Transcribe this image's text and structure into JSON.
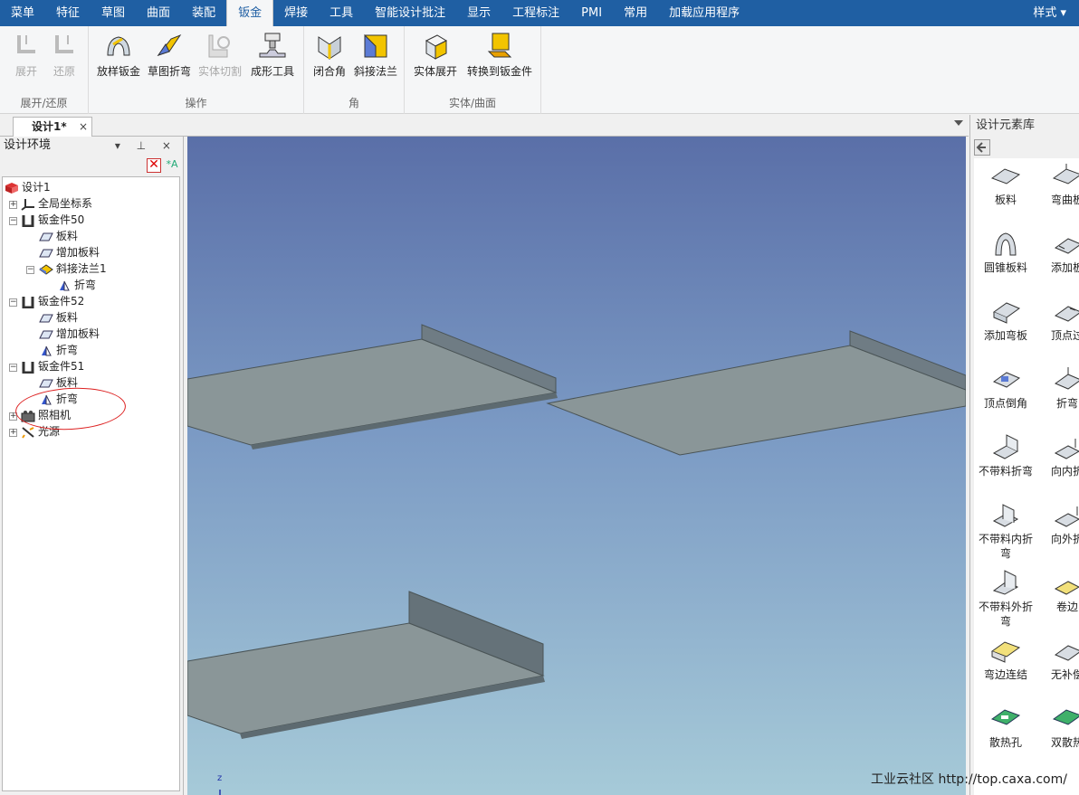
{
  "menubar": {
    "items": [
      "菜单",
      "特征",
      "草图",
      "曲面",
      "装配",
      "钣金",
      "焊接",
      "工具",
      "智能设计批注",
      "显示",
      "工程标注",
      "PMI",
      "常用",
      "加载应用程序"
    ],
    "active": "钣金",
    "style_menu": "样式 ▾"
  },
  "ribbon": {
    "groups": [
      {
        "label": "展开/还原",
        "buttons": [
          "展开",
          "还原"
        ]
      },
      {
        "label": "操作",
        "buttons": [
          "放样钣金",
          "草图折弯",
          "实体切割",
          "成形工具"
        ]
      },
      {
        "label": "角",
        "buttons": [
          "闭合角",
          "斜接法兰"
        ]
      },
      {
        "label": "实体/曲面",
        "buttons": [
          "实体展开",
          "转换到钣金件"
        ]
      }
    ]
  },
  "document": {
    "tab_label": "设计1*",
    "close": "×"
  },
  "left_panel": {
    "title": "设计环境",
    "header_buttons": "▾ ⊥ ×",
    "tree": [
      {
        "label": "设计1"
      },
      {
        "label": "全局坐标系"
      },
      {
        "label": "钣金件50"
      },
      {
        "label": "板料"
      },
      {
        "label": "增加板料"
      },
      {
        "label": "斜接法兰1"
      },
      {
        "label": "折弯"
      },
      {
        "label": "钣金件52"
      },
      {
        "label": "板料"
      },
      {
        "label": "增加板料"
      },
      {
        "label": "折弯"
      },
      {
        "label": "钣金件51"
      },
      {
        "label": "板料"
      },
      {
        "label": "折弯"
      },
      {
        "label": "照相机"
      },
      {
        "label": "光源"
      }
    ]
  },
  "viewport": {
    "axis_label": "z"
  },
  "right_panel": {
    "title": "设计元素库",
    "items": [
      {
        "label": "板料"
      },
      {
        "label": "弯曲板"
      },
      {
        "label": "圆锥板料"
      },
      {
        "label": "添加板"
      },
      {
        "label": "添加弯板"
      },
      {
        "label": "顶点过"
      },
      {
        "label": "顶点倒角"
      },
      {
        "label": "折弯"
      },
      {
        "label": "不带料折弯"
      },
      {
        "label": "向内折"
      },
      {
        "label": "不带料内折弯"
      },
      {
        "label": "向外折"
      },
      {
        "label": "不带料外折弯"
      },
      {
        "label": "卷边"
      },
      {
        "label": "弯边连结"
      },
      {
        "label": "无补偿"
      },
      {
        "label": "散热孔"
      },
      {
        "label": "双散热"
      }
    ]
  },
  "watermark": "工业云社区 http://top.caxa.com/",
  "colors": {
    "menubar": "#1f5fa3",
    "annotation": "#dd2222",
    "sheet": "#8a9698"
  }
}
